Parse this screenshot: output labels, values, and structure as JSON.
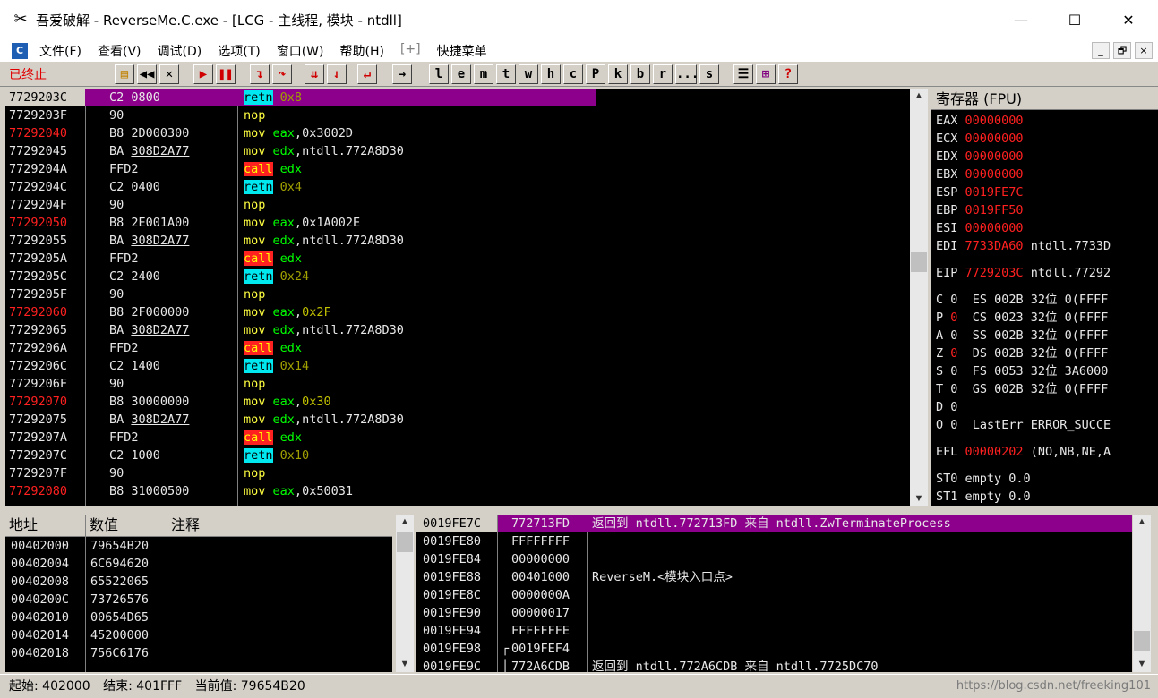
{
  "window": {
    "title": "吾爱破解 - ReverseMe.C.exe - [LCG - 主线程, 模块 - ntdll]",
    "minimize": "—",
    "maximize": "☐",
    "close": "✕"
  },
  "menu": {
    "items": [
      "文件(F)",
      "查看(V)",
      "调试(D)",
      "选项(T)",
      "窗口(W)",
      "帮助(H)",
      "[+]",
      "快捷菜单"
    ],
    "mdi": [
      "_",
      "🗗",
      "×"
    ]
  },
  "toolbar": {
    "status": "已终止",
    "letters": [
      "l",
      "e",
      "m",
      "t",
      "w",
      "h",
      "c",
      "P",
      "k",
      "b",
      "r",
      "...",
      "s"
    ]
  },
  "disasm": [
    {
      "addr": "7729203C",
      "hex": "C2 0800",
      "mn": "retn",
      "op": "0x8",
      "sel": true
    },
    {
      "addr": "7729203F",
      "hex": "90",
      "mn": "nop",
      "op": ""
    },
    {
      "addr": "77292040",
      "hex": "B8 2D000300",
      "mn": "mov",
      "op": "eax,0x3002D",
      "red": true
    },
    {
      "addr": "77292045",
      "hex": "BA 308D2A77",
      "mn": "mov",
      "op": "edx,ntdll.772A8D30",
      "ul": true
    },
    {
      "addr": "7729204A",
      "hex": "FFD2",
      "mn": "call",
      "op": "edx"
    },
    {
      "addr": "7729204C",
      "hex": "C2 0400",
      "mn": "retn",
      "op": "0x4"
    },
    {
      "addr": "7729204F",
      "hex": "90",
      "mn": "nop",
      "op": ""
    },
    {
      "addr": "77292050",
      "hex": "B8 2E001A00",
      "mn": "mov",
      "op": "eax,0x1A002E",
      "red": true
    },
    {
      "addr": "77292055",
      "hex": "BA 308D2A77",
      "mn": "mov",
      "op": "edx,ntdll.772A8D30",
      "ul": true
    },
    {
      "addr": "7729205A",
      "hex": "FFD2",
      "mn": "call",
      "op": "edx"
    },
    {
      "addr": "7729205C",
      "hex": "C2 2400",
      "mn": "retn",
      "op": "0x24"
    },
    {
      "addr": "7729205F",
      "hex": "90",
      "mn": "nop",
      "op": ""
    },
    {
      "addr": "77292060",
      "hex": "B8 2F000000",
      "mn": "mov",
      "op": "eax,0x2F",
      "red": true
    },
    {
      "addr": "77292065",
      "hex": "BA 308D2A77",
      "mn": "mov",
      "op": "edx,ntdll.772A8D30",
      "ul": true
    },
    {
      "addr": "7729206A",
      "hex": "FFD2",
      "mn": "call",
      "op": "edx"
    },
    {
      "addr": "7729206C",
      "hex": "C2 1400",
      "mn": "retn",
      "op": "0x14"
    },
    {
      "addr": "7729206F",
      "hex": "90",
      "mn": "nop",
      "op": ""
    },
    {
      "addr": "77292070",
      "hex": "B8 30000000",
      "mn": "mov",
      "op": "eax,0x30",
      "red": true
    },
    {
      "addr": "77292075",
      "hex": "BA 308D2A77",
      "mn": "mov",
      "op": "edx,ntdll.772A8D30",
      "ul": true
    },
    {
      "addr": "7729207A",
      "hex": "FFD2",
      "mn": "call",
      "op": "edx"
    },
    {
      "addr": "7729207C",
      "hex": "C2 1000",
      "mn": "retn",
      "op": "0x10"
    },
    {
      "addr": "7729207F",
      "hex": "90",
      "mn": "nop",
      "op": ""
    },
    {
      "addr": "77292080",
      "hex": "B8 31000500",
      "mn": "mov",
      "op": "eax,0x50031",
      "red": true
    }
  ],
  "registers": {
    "title": "寄存器 (FPU)",
    "gp": [
      {
        "n": "EAX",
        "v": "00000000",
        "c": ""
      },
      {
        "n": "ECX",
        "v": "00000000",
        "c": ""
      },
      {
        "n": "EDX",
        "v": "00000000",
        "c": ""
      },
      {
        "n": "EBX",
        "v": "00000000",
        "c": ""
      },
      {
        "n": "ESP",
        "v": "0019FE7C",
        "c": ""
      },
      {
        "n": "EBP",
        "v": "0019FF50",
        "c": ""
      },
      {
        "n": "ESI",
        "v": "00000000",
        "c": ""
      },
      {
        "n": "EDI",
        "v": "7733DA60",
        "c": "ntdll.7733D"
      }
    ],
    "eip": {
      "n": "EIP",
      "v": "7729203C",
      "c": "ntdll.77292"
    },
    "flags": [
      {
        "f": "C",
        "b": "0",
        "s": "ES 002B 32位 0(FFFF",
        "red": false
      },
      {
        "f": "P",
        "b": "0",
        "s": "CS 0023 32位 0(FFFF",
        "red": true
      },
      {
        "f": "A",
        "b": "0",
        "s": "SS 002B 32位 0(FFFF",
        "red": false
      },
      {
        "f": "Z",
        "b": "0",
        "s": "DS 002B 32位 0(FFFF",
        "red": true
      },
      {
        "f": "S",
        "b": "0",
        "s": "FS 0053 32位 3A6000",
        "red": false
      },
      {
        "f": "T",
        "b": "0",
        "s": "GS 002B 32位 0(FFFF",
        "red": false
      },
      {
        "f": "D",
        "b": "0",
        "s": "",
        "red": false
      },
      {
        "f": "O",
        "b": "0",
        "s": "LastErr ERROR_SUCCE",
        "red": false
      }
    ],
    "efl": {
      "n": "EFL",
      "v": "00000202",
      "c": "(NO,NB,NE,A"
    },
    "fpu": [
      "ST0 empty 0.0",
      "ST1 empty 0.0"
    ]
  },
  "dump": {
    "headers": [
      "地址",
      "数值",
      "注释"
    ],
    "rows": [
      [
        "00402000",
        "79654B20"
      ],
      [
        "00402004",
        "6C694620"
      ],
      [
        "00402008",
        "65522065"
      ],
      [
        "0040200C",
        "73726576"
      ],
      [
        "00402010",
        "00654D65"
      ],
      [
        "00402014",
        "45200000"
      ],
      [
        "00402018",
        "756C6176"
      ]
    ]
  },
  "stack": [
    {
      "a": "0019FE7C",
      "v": "772713FD",
      "c": "返回到 ntdll.772713FD 来自 ntdll.ZwTerminateProcess",
      "sel": true
    },
    {
      "a": "0019FE80",
      "v": "FFFFFFFF",
      "c": ""
    },
    {
      "a": "0019FE84",
      "v": "00000000",
      "c": ""
    },
    {
      "a": "0019FE88",
      "v": "00401000",
      "c": "ReverseM.<模块入口点>"
    },
    {
      "a": "0019FE8C",
      "v": "0000000A",
      "c": ""
    },
    {
      "a": "0019FE90",
      "v": "00000017",
      "c": ""
    },
    {
      "a": "0019FE94",
      "v": "FFFFFFFE",
      "c": ""
    },
    {
      "a": "0019FE98",
      "v": "0019FEF4",
      "c": "",
      "br": "┌"
    },
    {
      "a": "0019FE9C",
      "v": "772A6CDB",
      "c": "返回到 ntdll.772A6CDB 来自 ntdll.7725DC70",
      "br": "│"
    }
  ],
  "status": {
    "start_label": "起始:",
    "start": "402000",
    "end_label": "结束:",
    "end": "401FFF",
    "cur_label": "当前值:",
    "cur": "79654B20"
  },
  "watermark": "https://blog.csdn.net/freeking101"
}
